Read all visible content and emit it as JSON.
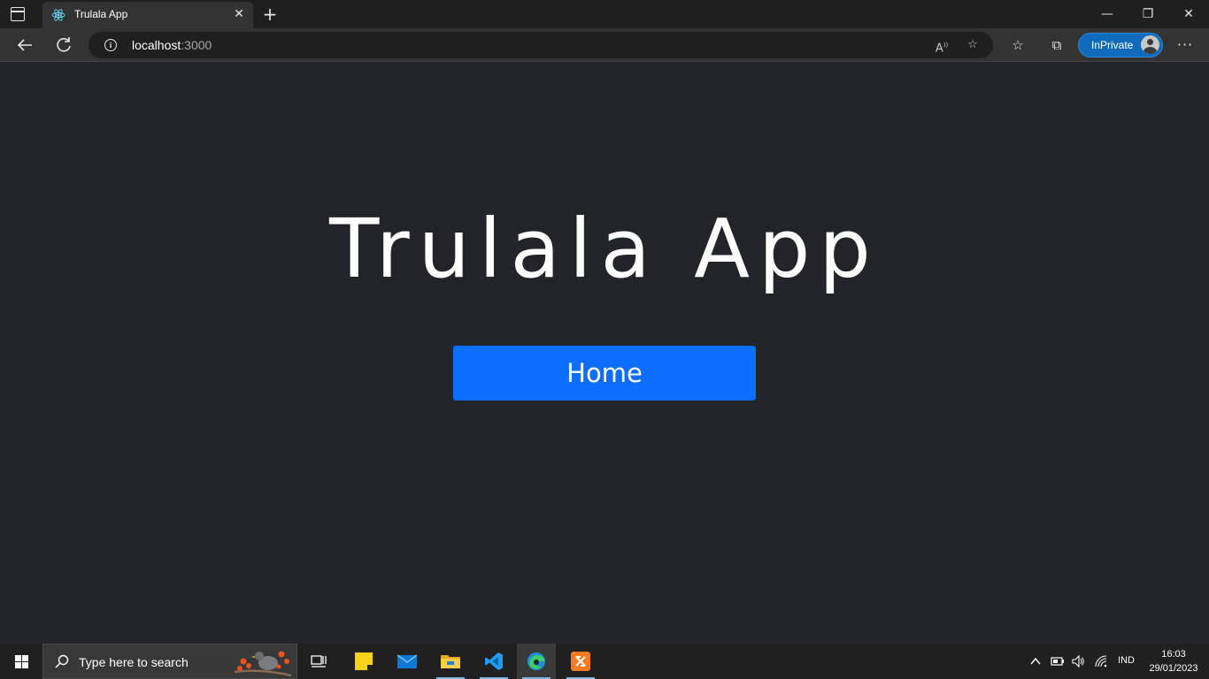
{
  "browser": {
    "tab": {
      "title": "Trulala App",
      "icon": "react-icon"
    },
    "new_tab_label": "+",
    "window_controls": {
      "minimize": "—",
      "restore": "❐",
      "close": "✕"
    },
    "address": {
      "host": "localhost",
      "port": ":3000"
    },
    "inprivate_label": "InPrivate",
    "more_label": "···"
  },
  "page": {
    "title": "Trulala App",
    "home_button": "Home"
  },
  "taskbar": {
    "search_placeholder": "Type here to search",
    "apps": [
      "task-view",
      "sticky-notes",
      "mail",
      "file-explorer",
      "vscode",
      "edge",
      "xampp"
    ],
    "tray": {
      "language": "IND"
    },
    "clock": {
      "time": "16:03",
      "date": "29/01/2023"
    }
  },
  "colors": {
    "page_background": "#212529",
    "primary_button": "#0d6efd",
    "inprivate": "#0f6cbd",
    "taskbar": "#202020"
  }
}
